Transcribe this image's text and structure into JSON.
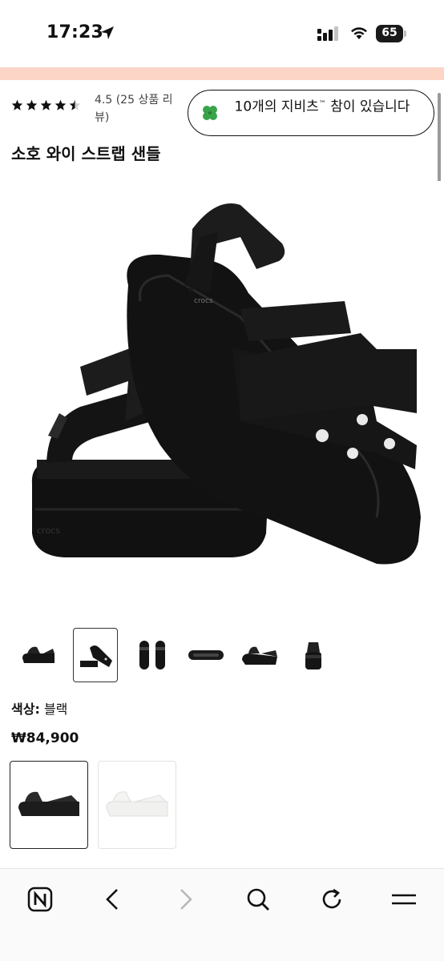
{
  "status_bar": {
    "time": "17:23",
    "battery": "65",
    "battery_level": 0.65
  },
  "rating": {
    "stars": 4.5,
    "text": "4.5 (25 상품 리뷰)"
  },
  "jibbitz": {
    "label": "10개의 지비츠",
    "tm": "™",
    "label_suffix": " 참이 있습니다"
  },
  "product": {
    "title": "소호 와이 스트랩 샌들",
    "color_label": "색상:",
    "color_value": "블랙",
    "price": "₩84,900"
  },
  "thumbnails": [
    "side-view",
    "pair-view",
    "top-view",
    "sole-view",
    "three-quarter-view",
    "back-view"
  ],
  "selected_thumbnail": 1,
  "swatches": [
    {
      "name": "black",
      "color": "#1c1c1c"
    },
    {
      "name": "white",
      "color": "#f1f1ef"
    }
  ],
  "colors": {
    "promo_strip": "#fcd5c7",
    "accent": "#111111"
  },
  "toolbar": {
    "icons": [
      "naver-icon",
      "back-icon",
      "forward-icon",
      "search-icon",
      "reload-icon",
      "menu-icon"
    ]
  }
}
